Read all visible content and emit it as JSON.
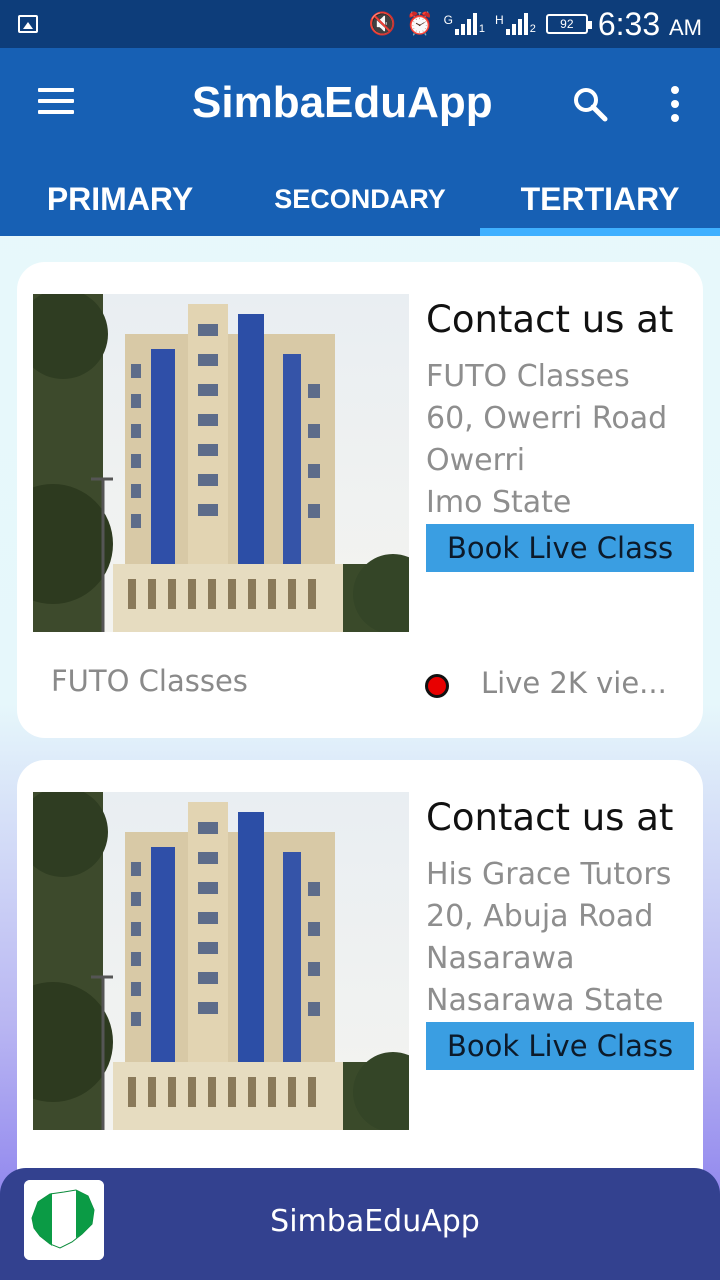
{
  "status_bar": {
    "time": "6:33",
    "ampm": "AM",
    "battery": "92",
    "sim1_label": "G",
    "sim2_label": "H",
    "sim1_index": "1",
    "sim2_index": "2"
  },
  "app_bar": {
    "title": "SimbaEduApp"
  },
  "tabs": [
    {
      "label": "PRIMARY"
    },
    {
      "label": "SECONDARY"
    },
    {
      "label": "TERTIARY"
    }
  ],
  "cards": [
    {
      "heading": "Contact us at",
      "address": [
        "FUTO Classes",
        "60, Owerri Road",
        "Owerri",
        "Imo State"
      ],
      "button": "Book Live Class",
      "footer_name": "FUTO Classes",
      "live_text": "Live  2K vie..."
    },
    {
      "heading": "Contact us at",
      "address": [
        "His Grace Tutors",
        "20, Abuja Road",
        "Nasarawa",
        "Nasarawa State"
      ],
      "button": "Book Live Class"
    }
  ],
  "bottom_bar": {
    "title": "SimbaEduApp"
  },
  "colors": {
    "status_bar": "#0d3d7a",
    "app_bar": "#1760b4",
    "tab_indicator": "#3fb0ff",
    "button": "#3a9ee2",
    "bottom_bar": "#33418f",
    "live_dot": "#e80000"
  },
  "icons": {
    "status_left": "image-icon",
    "mute": "mute-icon",
    "alarm": "alarm-icon",
    "menu": "hamburger-menu-icon",
    "search": "search-icon",
    "more": "more-vert-icon",
    "flag": "nigeria-map-flag-icon"
  }
}
